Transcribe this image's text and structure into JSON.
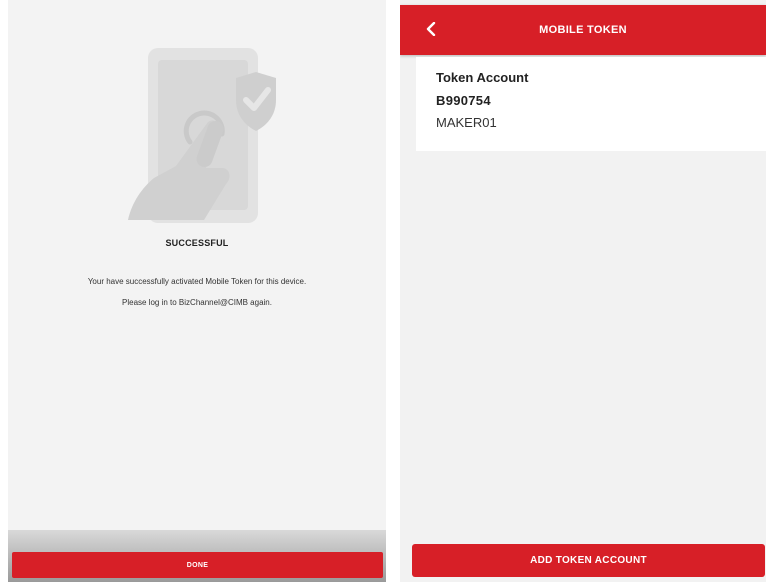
{
  "left_screen": {
    "title": "SUCCESSFUL",
    "message_line1": "Your have successfully activated Mobile Token for this device.",
    "message_line2": "Please log in to BizChannel@CIMB again.",
    "done_label": "DONE",
    "illustration_icon": "phone-touch-shield-check-icon"
  },
  "right_screen": {
    "header_title": "MOBILE TOKEN",
    "back_icon": "chevron-left-icon",
    "token_card": {
      "heading": "Token Account",
      "number": "B990754",
      "user": "MAKER01"
    },
    "add_button_label": "ADD TOKEN ACCOUNT"
  },
  "colors": {
    "brand_red": "#d71f27",
    "left_background": "#f3f3f3",
    "right_background": "#f2f2f2"
  }
}
